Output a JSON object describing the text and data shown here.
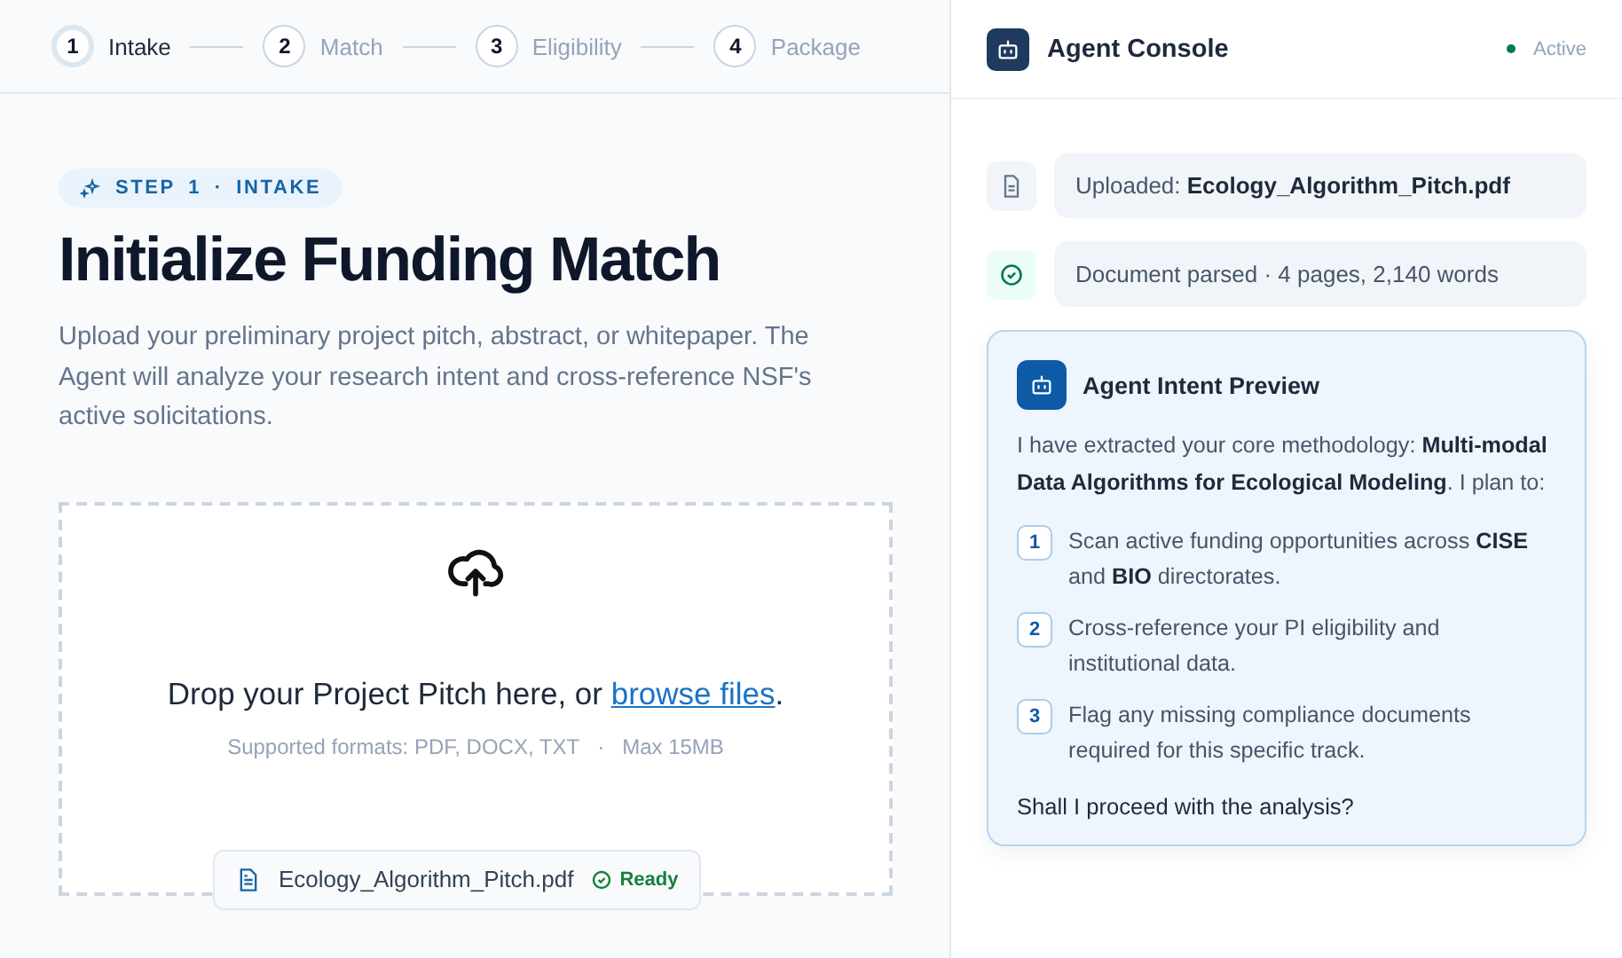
{
  "stepper": [
    {
      "number": "1",
      "label": "Intake",
      "selected": true
    },
    {
      "number": "2",
      "label": "Match",
      "selected": false
    },
    {
      "number": "3",
      "label": "Eligibility",
      "selected": false
    },
    {
      "number": "4",
      "label": "Package",
      "selected": false
    }
  ],
  "intake": {
    "badge": "STEP 1 · INTAKE",
    "title": "Initialize Funding Match",
    "description": "Upload your preliminary project pitch, abstract, or whitepaper. The Agent will analyze your research intent and cross-reference NSF's active solicitations.",
    "dropzone": {
      "prompt": "Drop your Project Pitch here, or ",
      "link": "browse files",
      "prompt_end": ".",
      "formats": "Supported formats: PDF, DOCX, TXT",
      "separator": "·",
      "max_size": "Max 15MB",
      "file": {
        "name": "Ecology_Algorithm_Pitch.pdf",
        "status": "Ready"
      }
    }
  },
  "console": {
    "title": "Agent Console",
    "status": "Active",
    "events": [
      {
        "kind": "file",
        "text": "Uploaded: **Ecology_Algorithm_Pitch.pdf**"
      },
      {
        "kind": "check",
        "text": "Document parsed · 4 pages, 2,140 words"
      }
    ],
    "preview": {
      "title": "Agent Intent Preview",
      "intro": "I have extracted your core methodology: **Multi-modal Data Algorithms for Ecological Modeling**. I plan to:",
      "steps": [
        {
          "number": "1",
          "text": "Scan active funding opportunities across **CISE** and **BIO** directorates."
        },
        {
          "number": "2",
          "text": "Cross-reference your PI eligibility and institutional data."
        },
        {
          "number": "3",
          "text": "Flag any missing compliance documents required for this specific track."
        }
      ],
      "question": "Shall I proceed with the analysis?"
    }
  }
}
